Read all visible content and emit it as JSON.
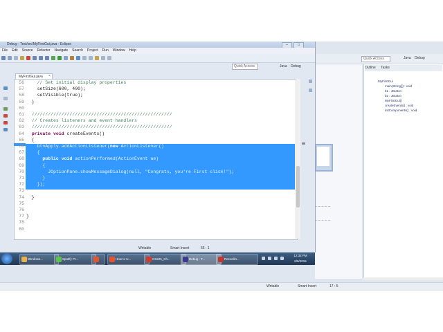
{
  "window": {
    "title": "Debug - Test/src/MyFirstGui.java - Eclipse",
    "controls": [
      "–",
      "□",
      "✕"
    ]
  },
  "menu": [
    "File",
    "Edit",
    "Source",
    "Refactor",
    "Navigate",
    "Search",
    "Project",
    "Run",
    "Window",
    "Help"
  ],
  "toolbar": {
    "quick_access_placeholder": "Quick Access",
    "perspectives": [
      "Java",
      "Debug"
    ]
  },
  "editor": {
    "tab_label": "MyFirstGui.java",
    "tab_close": "×",
    "lines": [
      {
        "num": "56",
        "text": "    // Set initial display properties",
        "type": "comment"
      },
      {
        "num": "57",
        "text": "    setSize(600, 400);",
        "type": "code"
      },
      {
        "num": "58",
        "text": "    setVisible(true);",
        "type": "code"
      },
      {
        "num": "59",
        "text": "  }",
        "type": "code"
      },
      {
        "num": "60",
        "text": "",
        "type": "code"
      },
      {
        "num": "61",
        "text": "  ////////////////////////////////////////////////////",
        "type": "comment"
      },
      {
        "num": "62",
        "text": "  // Creates listeners and event handlers",
        "type": "comment"
      },
      {
        "num": "63",
        "text": "  ////////////////////////////////////////////////////",
        "type": "comment"
      },
      {
        "num": "64",
        "text": "  private void createEvents()",
        "type": "code"
      },
      {
        "num": "65",
        "text": "  {",
        "type": "code"
      },
      {
        "num": "66",
        "text": "    btnApply.addActionListener(new ActionListener()",
        "type": "sel"
      },
      {
        "num": "67",
        "text": "    {",
        "type": "sel"
      },
      {
        "num": "68",
        "text": "      public void actionPerformed(ActionEvent ae)",
        "type": "sel"
      },
      {
        "num": "69",
        "text": "      {",
        "type": "sel"
      },
      {
        "num": "70",
        "text": "        JOptionPane.showMessageDialog(null, \"Congrats, you're First click!\");",
        "type": "sel"
      },
      {
        "num": "71",
        "text": "      }",
        "type": "sel"
      },
      {
        "num": "72",
        "text": "    });",
        "type": "sel"
      },
      {
        "num": "73",
        "text": "",
        "type": "code"
      },
      {
        "num": "74",
        "text": "  }",
        "type": "code"
      },
      {
        "num": "75",
        "text": "",
        "type": "code"
      },
      {
        "num": "76",
        "text": "",
        "type": "code"
      },
      {
        "num": "77",
        "text": "}",
        "type": "code"
      },
      {
        "num": "78",
        "text": "",
        "type": "code"
      },
      {
        "num": "80",
        "text": "",
        "type": "code"
      }
    ]
  },
  "status": {
    "writable": "Writable",
    "insert_mode": "Smart Insert",
    "position": "66 : 1"
  },
  "outline": {
    "tabs": [
      "Outline",
      "Tasks"
    ],
    "items": [
      "MyFirstGui",
      "main(String[]) : void",
      "b1 : JButton",
      "b2 : JButton",
      "MyFirstGui()",
      "createEvents() : void",
      "initComponents() : void"
    ]
  },
  "bg_window": {
    "quick_access_placeholder": "Quick Access",
    "perspectives": [
      "Java",
      "Debug"
    ],
    "status": {
      "writable": "Writable",
      "insert_mode": "Smart Insert",
      "position": "17 : 5"
    }
  },
  "taskbar": {
    "items": [
      {
        "label": "Windows...",
        "color": "#e8b24a"
      },
      {
        "label": "Spotify Pr...",
        "color": "#5cc34c"
      },
      {
        "label": "",
        "color": "#e5532f"
      },
      {
        "label": "How to U...",
        "color": "#e5532f"
      },
      {
        "label": "CS225_Ch...",
        "color": "#d43b2f"
      },
      {
        "label": "Debug - T...",
        "color": "#3c3c8f"
      },
      {
        "label": "Recordin...",
        "color": "#c0392b"
      }
    ],
    "time": "12:32 PM",
    "date": "6/5/2015"
  },
  "colors": {
    "selection": "#3399ff",
    "comment": "#3f7f5f",
    "keyword": "#7f0055"
  }
}
